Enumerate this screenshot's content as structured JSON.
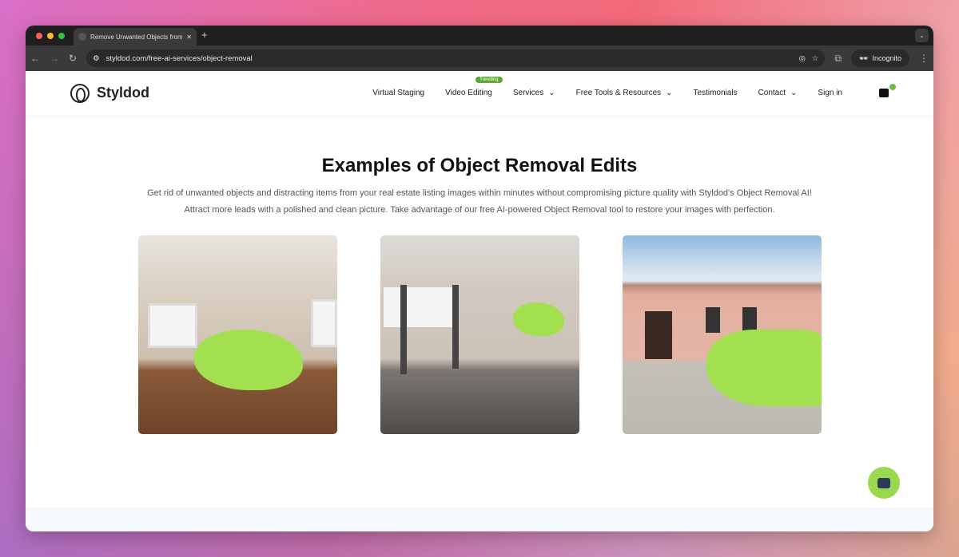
{
  "browser": {
    "tab_title": "Remove Unwanted Objects from",
    "url": "styldod.com/free-ai-services/object-removal",
    "incognito_label": "Incognito"
  },
  "site": {
    "logo": "Styldod",
    "nav": [
      {
        "label": "Virtual Staging"
      },
      {
        "label": "Video Editing",
        "badge": "Trending"
      },
      {
        "label": "Services",
        "dropdown": true
      },
      {
        "label": "Free Tools & Resources",
        "dropdown": true
      },
      {
        "label": "Testimonials"
      },
      {
        "label": "Contact",
        "dropdown": true
      },
      {
        "label": "Sign in"
      }
    ],
    "cart_count": "0"
  },
  "main": {
    "title": "Examples of Object Removal Edits",
    "desc1": "Get rid of unwanted objects and distracting items from your real estate listing images within minutes without compromising picture quality with Styldod's Object Removal AI!",
    "desc2": "Attract more leads with a polished and clean picture. Take advantage of our free AI-powered Object Removal tool to restore your images with perfection."
  },
  "colors": {
    "accent": "#a3e050",
    "badge": "#5fa832"
  }
}
